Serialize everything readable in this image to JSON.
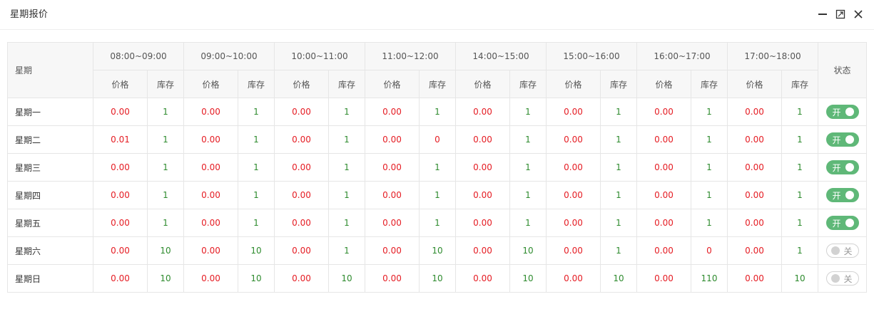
{
  "window": {
    "title": "星期报价",
    "icons": [
      "minimize-icon",
      "maximize-icon",
      "close-icon"
    ]
  },
  "table": {
    "day_header": "星期",
    "status_header": "状态",
    "price_label": "价格",
    "stock_label": "库存",
    "slots": [
      "08:00~09:00",
      "09:00~10:00",
      "10:00~11:00",
      "11:00~12:00",
      "14:00~15:00",
      "15:00~16:00",
      "16:00~17:00",
      "17:00~18:00"
    ],
    "rows": [
      {
        "day": "星期一",
        "cells": [
          [
            "0.00",
            "1"
          ],
          [
            "0.00",
            "1"
          ],
          [
            "0.00",
            "1"
          ],
          [
            "0.00",
            "1"
          ],
          [
            "0.00",
            "1"
          ],
          [
            "0.00",
            "1"
          ],
          [
            "0.00",
            "1"
          ],
          [
            "0.00",
            "1"
          ]
        ],
        "status": "开",
        "on": true
      },
      {
        "day": "星期二",
        "cells": [
          [
            "0.01",
            "1"
          ],
          [
            "0.00",
            "1"
          ],
          [
            "0.00",
            "1"
          ],
          [
            "0.00",
            "0"
          ],
          [
            "0.00",
            "1"
          ],
          [
            "0.00",
            "1"
          ],
          [
            "0.00",
            "1"
          ],
          [
            "0.00",
            "1"
          ]
        ],
        "status": "开",
        "on": true
      },
      {
        "day": "星期三",
        "cells": [
          [
            "0.00",
            "1"
          ],
          [
            "0.00",
            "1"
          ],
          [
            "0.00",
            "1"
          ],
          [
            "0.00",
            "1"
          ],
          [
            "0.00",
            "1"
          ],
          [
            "0.00",
            "1"
          ],
          [
            "0.00",
            "1"
          ],
          [
            "0.00",
            "1"
          ]
        ],
        "status": "开",
        "on": true
      },
      {
        "day": "星期四",
        "cells": [
          [
            "0.00",
            "1"
          ],
          [
            "0.00",
            "1"
          ],
          [
            "0.00",
            "1"
          ],
          [
            "0.00",
            "1"
          ],
          [
            "0.00",
            "1"
          ],
          [
            "0.00",
            "1"
          ],
          [
            "0.00",
            "1"
          ],
          [
            "0.00",
            "1"
          ]
        ],
        "status": "开",
        "on": true
      },
      {
        "day": "星期五",
        "cells": [
          [
            "0.00",
            "1"
          ],
          [
            "0.00",
            "1"
          ],
          [
            "0.00",
            "1"
          ],
          [
            "0.00",
            "1"
          ],
          [
            "0.00",
            "1"
          ],
          [
            "0.00",
            "1"
          ],
          [
            "0.00",
            "1"
          ],
          [
            "0.00",
            "1"
          ]
        ],
        "status": "开",
        "on": true
      },
      {
        "day": "星期六",
        "cells": [
          [
            "0.00",
            "10"
          ],
          [
            "0.00",
            "10"
          ],
          [
            "0.00",
            "1"
          ],
          [
            "0.00",
            "10"
          ],
          [
            "0.00",
            "10"
          ],
          [
            "0.00",
            "1"
          ],
          [
            "0.00",
            "0"
          ],
          [
            "0.00",
            "1"
          ]
        ],
        "status": "关",
        "on": false
      },
      {
        "day": "星期日",
        "cells": [
          [
            "0.00",
            "10"
          ],
          [
            "0.00",
            "10"
          ],
          [
            "0.00",
            "10"
          ],
          [
            "0.00",
            "10"
          ],
          [
            "0.00",
            "10"
          ],
          [
            "0.00",
            "10"
          ],
          [
            "0.00",
            "110"
          ],
          [
            "0.00",
            "10"
          ]
        ],
        "status": "关",
        "on": false
      }
    ]
  },
  "colors": {
    "price": "#e51c23",
    "stock": "#2e8b2e",
    "switch_on": "#5fb878",
    "switch_off_border": "#d2d2d2",
    "header_bg": "#f7f7f7"
  }
}
